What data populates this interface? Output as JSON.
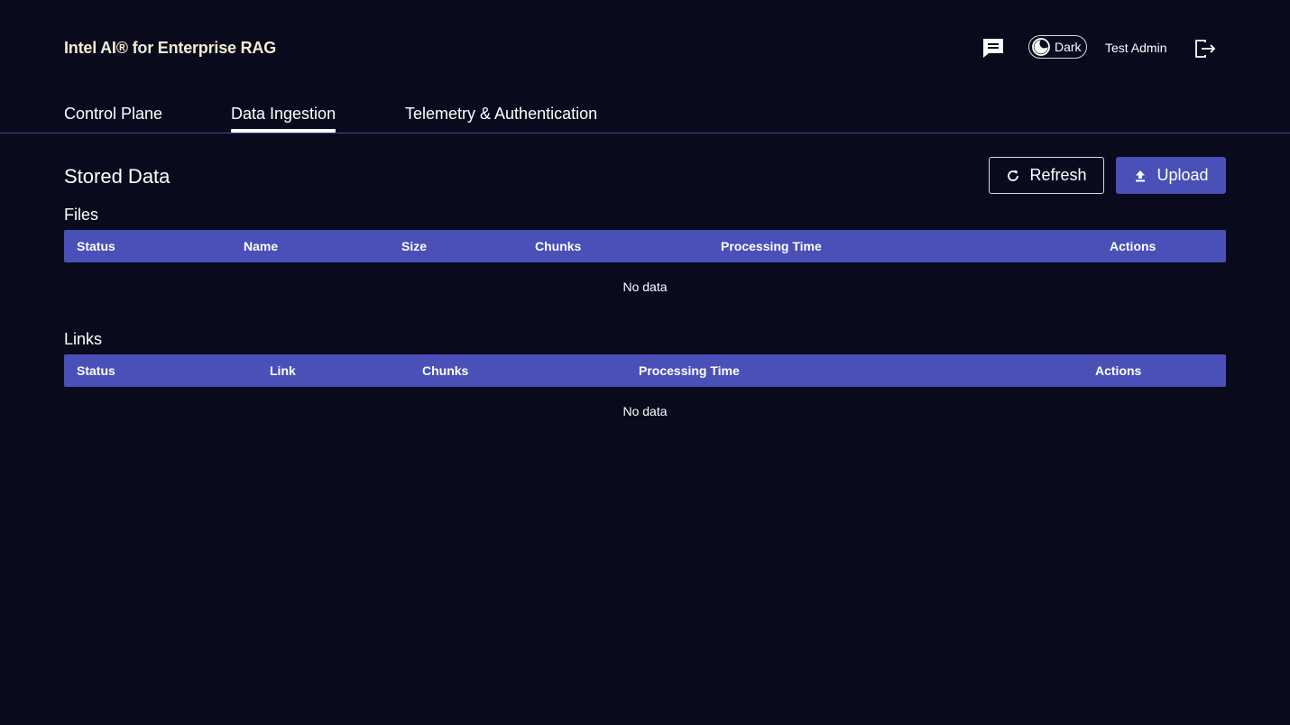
{
  "header": {
    "app_title": "Intel AI® for Enterprise RAG",
    "chat_icon": "chat-icon",
    "theme_toggle_label": "Dark",
    "theme_icon": "moon-icon",
    "user_name": "Test Admin",
    "logout_icon": "logout-icon"
  },
  "tabs": [
    {
      "label": "Control Plane",
      "active": false
    },
    {
      "label": "Data Ingestion",
      "active": true
    },
    {
      "label": "Telemetry & Authentication",
      "active": false
    }
  ],
  "main": {
    "title": "Stored Data",
    "refresh_label": "Refresh",
    "refresh_icon": "refresh-icon",
    "upload_label": "Upload",
    "upload_icon": "upload-icon"
  },
  "files": {
    "heading": "Files",
    "columns": [
      "Status",
      "Name",
      "Size",
      "Chunks",
      "Processing Time",
      "Actions"
    ],
    "empty_text": "No data"
  },
  "links": {
    "heading": "Links",
    "columns": [
      "Status",
      "Link",
      "Chunks",
      "Processing Time",
      "Actions"
    ],
    "empty_text": "No data"
  },
  "colors": {
    "background": "#0a0a1d",
    "accent": "#4a50b7",
    "title_text": "#f3ecd6",
    "divider": "#434a9c"
  }
}
